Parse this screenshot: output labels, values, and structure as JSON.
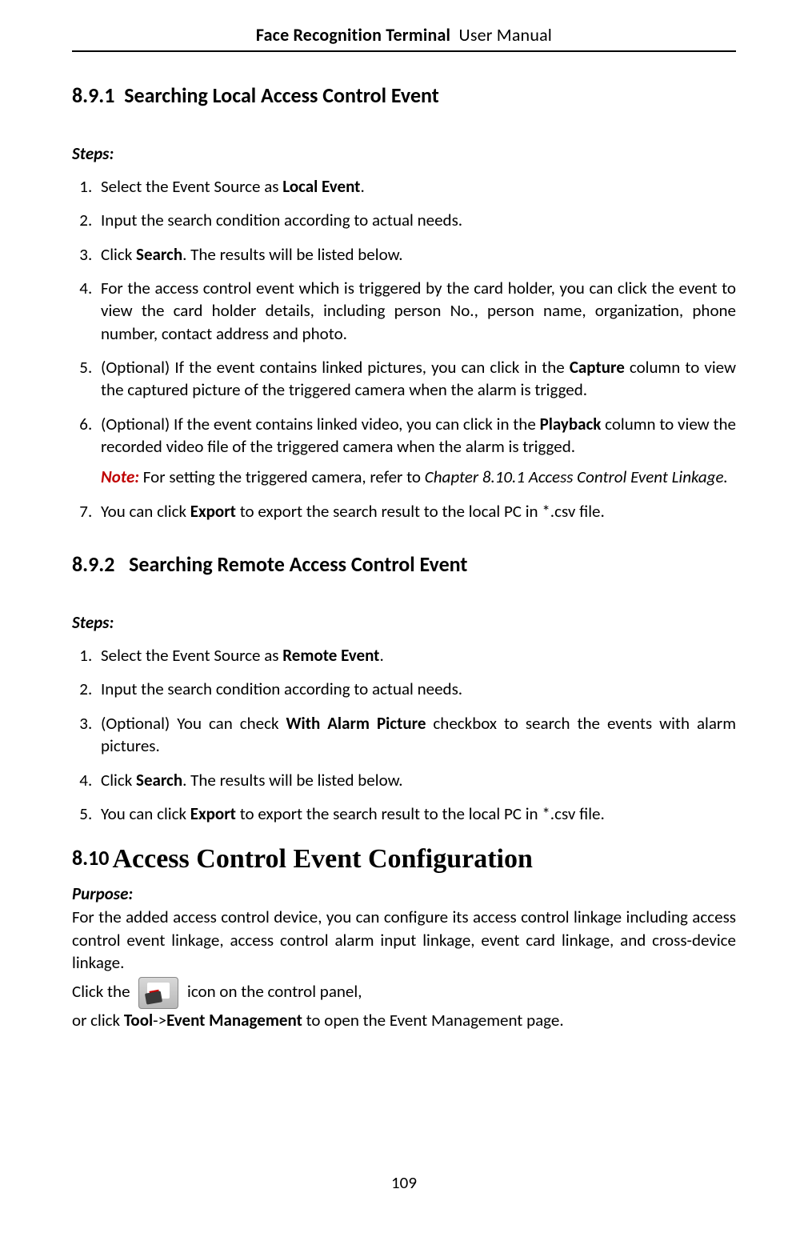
{
  "header": {
    "title_bold": "Face Recognition Terminal",
    "title_light": "User Manual"
  },
  "section1": {
    "number": "8.9.1",
    "title": "Searching Local Access Control Event",
    "steps_label": "Steps:",
    "steps": {
      "s1_a": "Select the Event Source as ",
      "s1_b": "Local Event",
      "s1_c": ".",
      "s2": "Input the search condition according to actual needs.",
      "s3_a": "Click ",
      "s3_b": "Search",
      "s3_c": ". The results will be listed below.",
      "s4": "For the access control event which is triggered by the card holder, you can click the event to view the card holder details, including person No., person name, organization, phone number, contact address and photo.",
      "s5_a": "(Optional) If the event contains linked pictures, you can click in the ",
      "s5_b": "Capture",
      "s5_c": " column to view the captured picture of the triggered camera when the alarm is trigged.",
      "s6_a": "(Optional) If the event contains linked video, you can click in the ",
      "s6_b": "Playback",
      "s6_c": " column to view the recorded video file of the triggered camera when the alarm is trigged.",
      "note_label": "Note:",
      "note_a": " For setting the triggered camera, refer to ",
      "note_b": "Chapter 8.10.1 Access Control Event Linkage.",
      "s7_a": "You can click ",
      "s7_b": "Export",
      "s7_c": " to export the search result to the local PC in *.csv file."
    }
  },
  "section2": {
    "number": "8.9.2",
    "title": "Searching Remote Access Control Event",
    "steps_label": "Steps:",
    "steps": {
      "s1_a": "Select the Event Source as ",
      "s1_b": "Remote Event",
      "s1_c": ".",
      "s2": "Input the search condition according to actual needs.",
      "s3_a": "(Optional) You can check ",
      "s3_b": "With Alarm Picture",
      "s3_c": " checkbox to search the events with alarm pictures.",
      "s4_a": "Click ",
      "s4_b": "Search",
      "s4_c": ". The results will be listed below.",
      "s5_a": "You can click ",
      "s5_b": "Export",
      "s5_c": " to export the search result to the local PC in *.csv file."
    }
  },
  "section3": {
    "number": "8.10",
    "title": "Access Control Event Configuration",
    "purpose_label": "Purpose:",
    "purpose_text": "For the added access control device, you can configure its access control linkage including access control event linkage, access control alarm input linkage, event card linkage, and cross-device linkage.",
    "click_a": "Click the ",
    "click_b": " icon on the control panel,",
    "or_a": "or click ",
    "or_b": "Tool",
    "or_c": "->",
    "or_d": "Event Management",
    "or_e": " to open the Event Management page."
  },
  "page_number": "109"
}
